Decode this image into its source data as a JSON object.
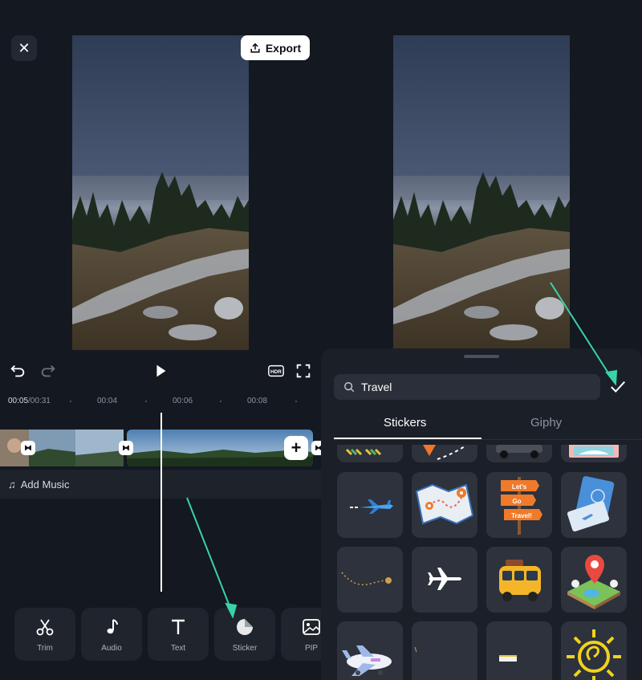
{
  "editor": {
    "close_icon": "close-icon",
    "export_label": "Export",
    "time_current": "00:05",
    "time_total": "/00:31",
    "ticks": [
      "00:04",
      "00:06",
      "00:08"
    ],
    "add_music_label": "Add Music",
    "tools": [
      {
        "label": "Trim",
        "icon": "scissors-icon"
      },
      {
        "label": "Audio",
        "icon": "music-note-icon"
      },
      {
        "label": "Text",
        "icon": "text-icon"
      },
      {
        "label": "Sticker",
        "icon": "sticker-icon"
      },
      {
        "label": "PIP",
        "icon": "image-icon"
      }
    ]
  },
  "sticker_panel": {
    "search_value": "Travel",
    "tabs": [
      "Stickers",
      "Giphy"
    ],
    "active_tab": "Stickers",
    "stickers": [
      "flags-sticker",
      "pin-route-sticker",
      "car-sticker",
      "ticket-sticker",
      "airplane-blue-sticker",
      "map-sticker",
      "lets-go-travel-sign-sticker",
      "passport-sticker",
      "dotted-path-sticker",
      "airplane-white-sticker",
      "yellow-bus-sticker",
      "location-island-sticker",
      "toy-airplane-sticker",
      "blank-sticker",
      "bar-sticker",
      "sun-sticker"
    ],
    "sign_text": [
      "Let's",
      "Go",
      "Travel!"
    ]
  },
  "colors": {
    "background": "#141820",
    "panel": "#1b1f27",
    "accent_arrow": "#38d4a8"
  }
}
